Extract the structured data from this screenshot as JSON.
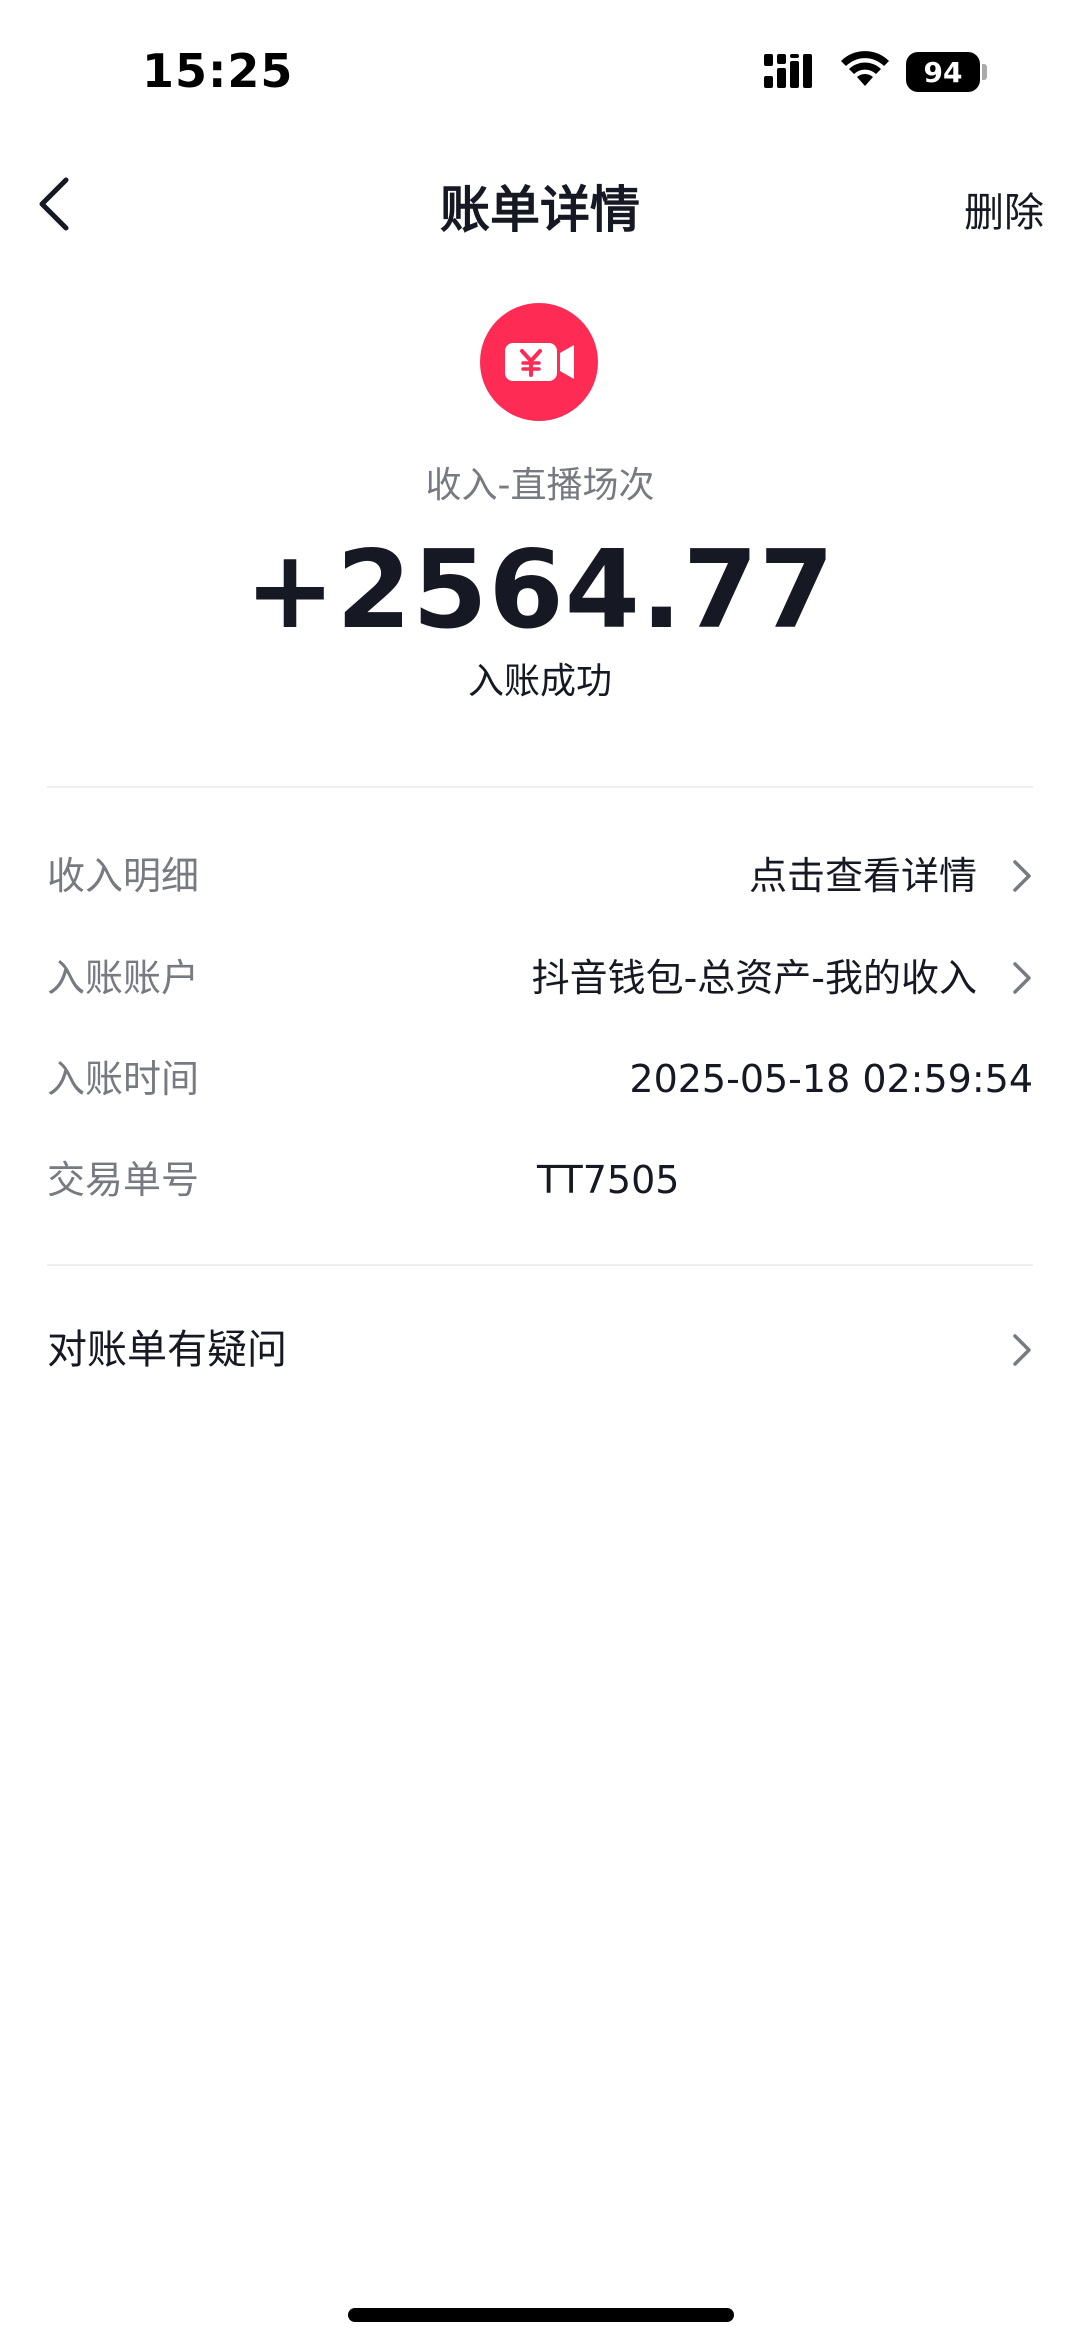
{
  "status_bar": {
    "time": "15:25",
    "battery": "94",
    "icons": [
      "signal-icon",
      "wifi-icon",
      "battery-icon"
    ]
  },
  "nav": {
    "title": "账单详情",
    "delete_label": "删除",
    "back_icon": "chevron-left-icon"
  },
  "header": {
    "icon": "live-income-icon",
    "icon_color": "#fe2c55",
    "category": "收入-直播场次",
    "amount": "+2564.77",
    "status": "入账成功"
  },
  "details": [
    {
      "label": "收入明细",
      "value": "点击查看详情",
      "has_chevron": true
    },
    {
      "label": "入账账户",
      "value": "抖音钱包-总资产-我的收入",
      "has_chevron": true
    },
    {
      "label": "入账时间",
      "value": "2025-05-18 02:59:54",
      "has_chevron": false
    },
    {
      "label": "交易单号",
      "value": "TT7505",
      "has_chevron": false
    }
  ],
  "question": {
    "label": "对账单有疑问"
  },
  "colors": {
    "accent": "#fe2c55",
    "text_primary": "#161823",
    "text_secondary": "#777a80"
  }
}
